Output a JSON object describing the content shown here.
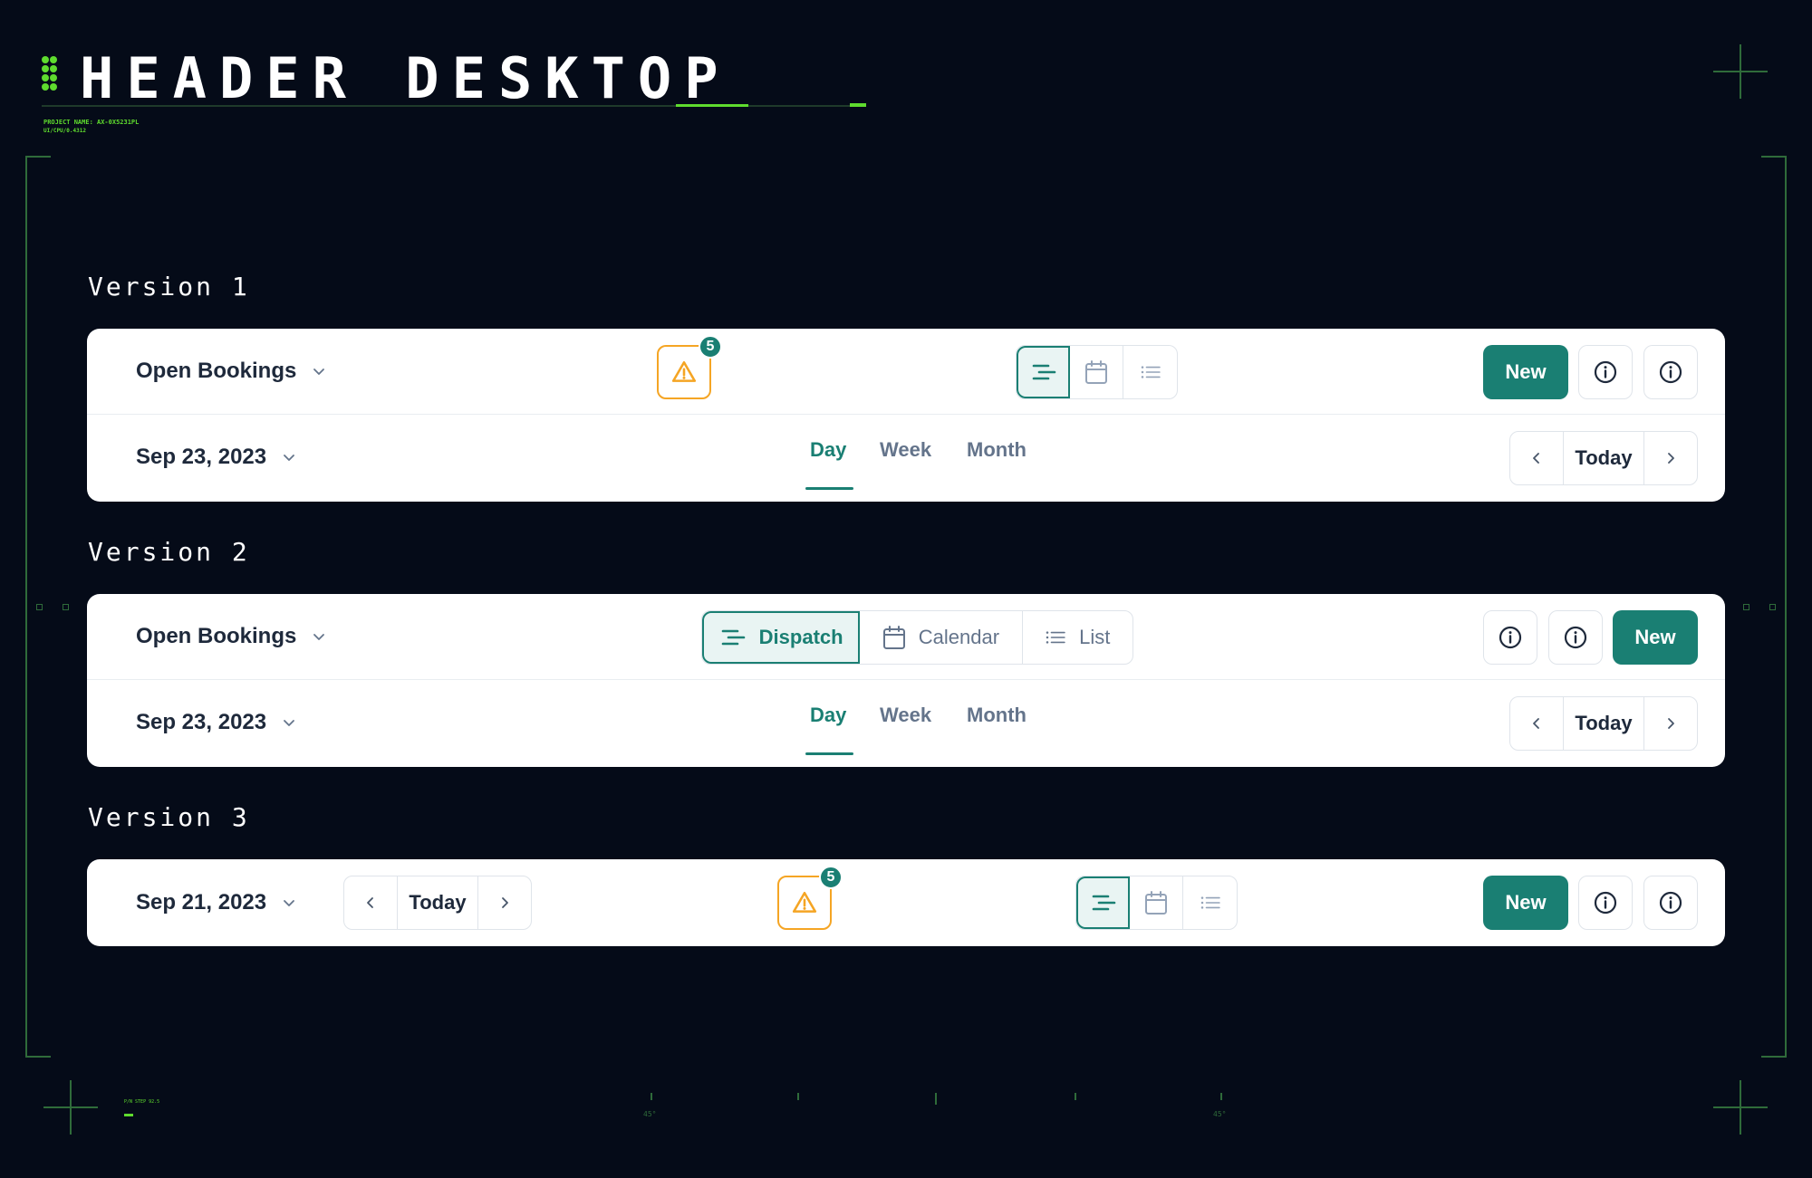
{
  "page": {
    "title": "HEADER DESKTOP",
    "project_name": "PROJECT NAME: AX-0X5231PL",
    "meta_code": "UI/CPU/0.4312",
    "footer_meta": "P/N STEP 92.5",
    "degree_labels": [
      "45°",
      "45°"
    ]
  },
  "colors": {
    "accent": "#1a7f73",
    "warning": "#f5a524",
    "background": "#050b18",
    "hud_green": "#5fdc2e"
  },
  "versions": [
    {
      "label": "Version 1",
      "filter": {
        "label": "Open Bookings"
      },
      "alert": {
        "count": "5",
        "icon": "warning-triangle-icon"
      },
      "view_switcher": [
        {
          "icon": "dispatch-icon",
          "label": "",
          "active": true
        },
        {
          "icon": "calendar-icon",
          "label": "",
          "active": false
        },
        {
          "icon": "list-icon",
          "label": "",
          "active": false
        }
      ],
      "new_label": "New",
      "info_icons": [
        "info-icon",
        "info-icon"
      ],
      "date": "Sep 23, 2023",
      "tabs": [
        {
          "label": "Day",
          "active": true
        },
        {
          "label": "Week",
          "active": false
        },
        {
          "label": "Month",
          "active": false
        }
      ],
      "today_label": "Today"
    },
    {
      "label": "Version 2",
      "filter": {
        "label": "Open Bookings"
      },
      "view_switcher": [
        {
          "icon": "dispatch-icon",
          "label": "Dispatch",
          "active": true
        },
        {
          "icon": "calendar-icon",
          "label": "Calendar",
          "active": false
        },
        {
          "icon": "list-icon",
          "label": "List",
          "active": false
        }
      ],
      "new_label": "New",
      "info_icons": [
        "info-icon",
        "info-icon"
      ],
      "date": "Sep 23, 2023",
      "tabs": [
        {
          "label": "Day",
          "active": true
        },
        {
          "label": "Week",
          "active": false
        },
        {
          "label": "Month",
          "active": false
        }
      ],
      "today_label": "Today"
    },
    {
      "label": "Version 3",
      "date": "Sep 21, 2023",
      "today_label": "Today",
      "alert": {
        "count": "5",
        "icon": "warning-triangle-icon"
      },
      "view_switcher": [
        {
          "icon": "dispatch-icon",
          "label": "",
          "active": true
        },
        {
          "icon": "calendar-icon",
          "label": "",
          "active": false
        },
        {
          "icon": "list-icon",
          "label": "",
          "active": false
        }
      ],
      "new_label": "New",
      "info_icons": [
        "info-icon",
        "info-icon"
      ]
    }
  ]
}
